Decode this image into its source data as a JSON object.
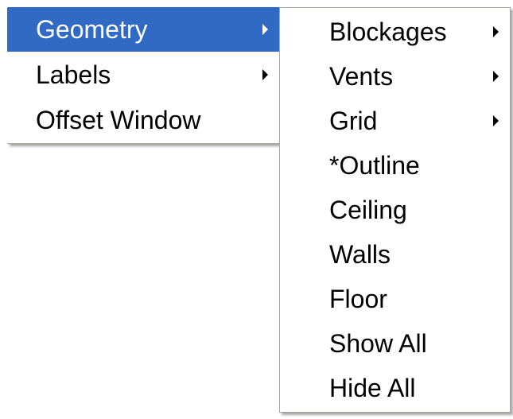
{
  "main_menu": {
    "items": [
      {
        "label": "Geometry",
        "has_submenu": true,
        "selected": true
      },
      {
        "label": "Labels",
        "has_submenu": true,
        "selected": false
      },
      {
        "label": "Offset Window",
        "has_submenu": false,
        "selected": false
      }
    ]
  },
  "geometry_submenu": {
    "items": [
      {
        "label": "Blockages",
        "has_submenu": true
      },
      {
        "label": "Vents",
        "has_submenu": true
      },
      {
        "label": "Grid",
        "has_submenu": true
      },
      {
        "label": "*Outline",
        "has_submenu": false
      },
      {
        "label": "Ceiling",
        "has_submenu": false
      },
      {
        "label": "Walls",
        "has_submenu": false
      },
      {
        "label": "Floor",
        "has_submenu": false
      },
      {
        "label": "Show All",
        "has_submenu": false
      },
      {
        "label": "Hide All",
        "has_submenu": false
      }
    ]
  },
  "colors": {
    "selection_background": "#316ac5",
    "selection_text": "#ffffff",
    "menu_border": "#aca899"
  }
}
